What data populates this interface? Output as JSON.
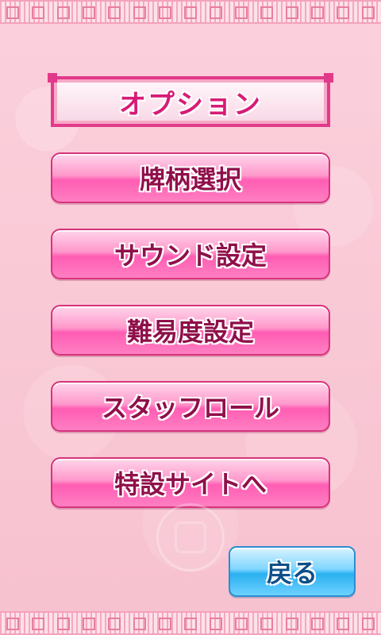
{
  "title": "オプション",
  "menu": {
    "items": [
      {
        "label": "牌柄選択"
      },
      {
        "label": "サウンド設定"
      },
      {
        "label": "難易度設定"
      },
      {
        "label": "スタッフロール"
      },
      {
        "label": "特設サイトへ"
      }
    ]
  },
  "back_button": {
    "label": "戻る"
  },
  "colors": {
    "background": "#f9c6d4",
    "menu_button": "#ff66b8",
    "back_button": "#36b3f2",
    "title_border": "#e23a8a"
  }
}
